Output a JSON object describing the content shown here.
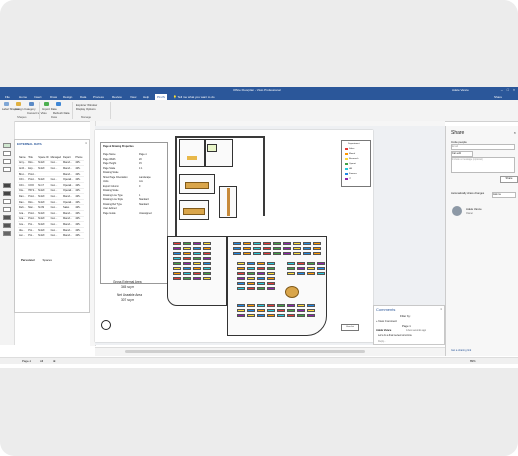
{
  "window": {
    "title": "Office Floorplan - Visio Professional",
    "user": "Adele Vance"
  },
  "menu": {
    "tabs": [
      "File",
      "Home",
      "Insert",
      "Draw",
      "Design",
      "Data",
      "Process",
      "Review",
      "View",
      "Help",
      "PLUS"
    ],
    "active_tab": "PLUS",
    "tell_me": "Tell me what you want to do",
    "share": "Share"
  },
  "ribbon": {
    "buttons": [
      "Label Shapes",
      "Assign Category",
      "Convert to Visio",
      "Import Data",
      "Refresh Data",
      "Explorer Window",
      "Display Options"
    ],
    "groups": [
      "Shapes",
      "Data",
      "Manage"
    ]
  },
  "external_data": {
    "header": "EXTERNAL DATA",
    "columns": [
      "Name",
      "Title",
      "Space ID",
      "Managed",
      "Depart",
      "Phone"
    ],
    "rows": [
      [
        "Amy...",
        "Dire...",
        "M-EX",
        "Cen...",
        "Manuf...",
        "425-"
      ],
      [
        "Anth...",
        "Exp...",
        "M-EX",
        "Cen...",
        "Manuf...",
        "425-"
      ],
      [
        "Bret...",
        "Prod...",
        "",
        "",
        "Manuf...",
        "425-"
      ],
      [
        "Chri...",
        "Prod...",
        "M-EX",
        "Cen...",
        "Operati...",
        "425-"
      ],
      [
        "Chri...",
        "COO",
        "M-17",
        "Cen...",
        "Operati...",
        "425-"
      ],
      [
        "Cla...",
        "HR S...",
        "M-EX",
        "Cen...",
        "Operati...",
        "425-"
      ],
      [
        "Dan...",
        "Prod...",
        "M-EX",
        "Cen...",
        "Manuf...",
        "425-"
      ],
      [
        "Dav...",
        "Dire...",
        "M-EX",
        "Cen...",
        "Operati...",
        "425-"
      ],
      [
        "Deb...",
        "Mar...",
        "M-09",
        "Cen...",
        "Sales",
        "425-"
      ],
      [
        "Gra...",
        "Prod...",
        "M-EX",
        "Cen...",
        "Manuf...",
        "425-"
      ],
      [
        "Gra...",
        "Prod...",
        "M-EX",
        "Cen...",
        "Manuf...",
        "425-"
      ],
      [
        "Gre...",
        "Pro...",
        "M-EX",
        "Cen...",
        "Manuf...",
        "425-"
      ],
      [
        "Ida...",
        "Pro...",
        "M-EX",
        "Cen...",
        "Manuf...",
        "425-"
      ],
      [
        "Jen...",
        "Pro...",
        "M-EX",
        "Cen...",
        "Manuf...",
        "425-"
      ]
    ],
    "tabs": [
      "Personnel",
      "Spaces"
    ]
  },
  "properties": {
    "title": "Page & Drawing Properties",
    "rows": [
      [
        "Page Name",
        "Page-1"
      ],
      [
        "Page Width",
        "20"
      ],
      [
        "Page Height",
        "15"
      ],
      [
        "Page Scale",
        "1:1"
      ],
      [
        "Drawing Scale",
        ""
      ],
      [
        "Show Page Orientation",
        "Landscape"
      ],
      [
        "Units",
        "mm"
      ],
      [
        "Export Column",
        "0"
      ],
      [
        "Drawing Scale",
        ""
      ],
      [
        "Drawing Line Type",
        "1"
      ],
      [
        "Drawing Line Style",
        "Standard"
      ],
      [
        "Drawing Ref Type",
        "Standard"
      ],
      [
        "User defined",
        ""
      ],
      [
        "Page Guide",
        "Unassigned"
      ]
    ]
  },
  "legend": {
    "title": "Department",
    "items": [
      "Sales",
      "Manuf",
      "Research",
      "Operat",
      "HR",
      "Finance",
      "IT"
    ],
    "colors": [
      "#e53935",
      "#ff9800",
      "#fdd835",
      "#43a047",
      "#26c6da",
      "#1e88e5",
      "#8e24aa"
    ]
  },
  "plan": {
    "gross_area_label": "Gross External Area",
    "gross_area_value": "345 sq m",
    "net_area_label": "Net Useable Area",
    "net_area_value": "307 sq m",
    "user_list": "User list"
  },
  "comments": {
    "title": "Comments",
    "filter": "Filter by:",
    "new": "New Comment",
    "page": "Page 1",
    "author": "Adele Vance",
    "time": "A few seconds ago",
    "text": "Let's do a final review tomorrow.",
    "reply": "Reply..."
  },
  "share": {
    "title": "Share",
    "invite": "Invite people",
    "field_placeholder": "Email",
    "can_edit": "Can edit",
    "message": "Include a message (optional)",
    "button": "Share",
    "auto_share": "Automatically share changes",
    "auto_value": "Ask me",
    "owner_name": "Adele Vance",
    "owner_role": "Owner",
    "footer_link": "Get a sharing link"
  },
  "status": {
    "page": "Page-1",
    "all": "All",
    "zoom": "89%"
  }
}
